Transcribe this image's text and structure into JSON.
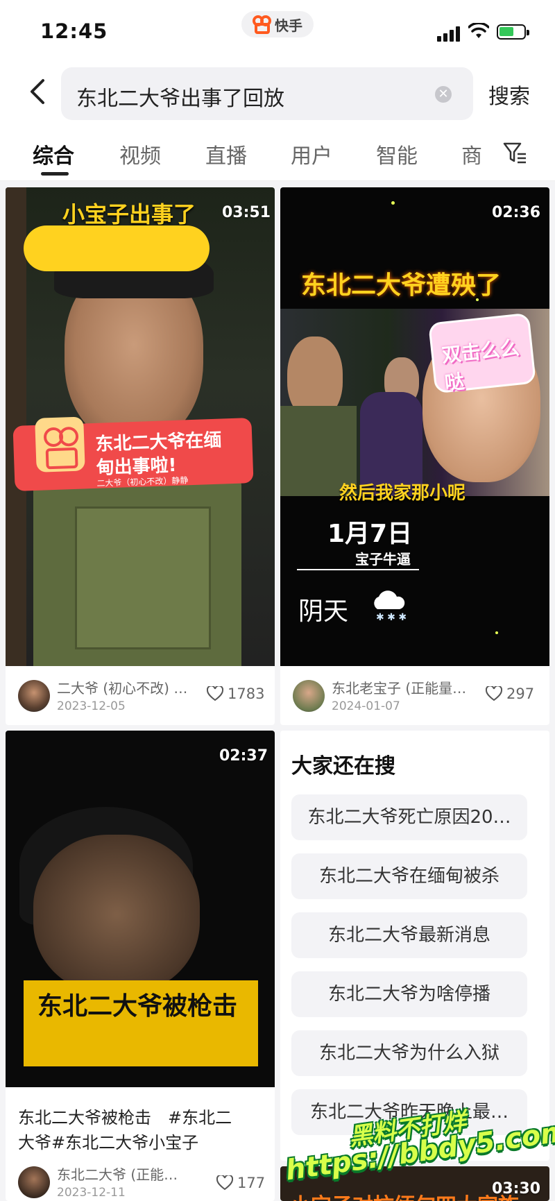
{
  "status": {
    "time": "12:45",
    "app_name": "快手"
  },
  "search": {
    "query": "东北二大爷出事了回放",
    "button_label": "搜索"
  },
  "tabs": [
    {
      "label": "综合",
      "active": true
    },
    {
      "label": "视频"
    },
    {
      "label": "直播"
    },
    {
      "label": "用户"
    },
    {
      "label": "智能"
    },
    {
      "label": "商"
    }
  ],
  "cards": [
    {
      "duration": "03:51",
      "overlay_title": "小宝子出事了",
      "banner_line1": "东北二大爷在缅",
      "banner_line2": "甸出事啦!",
      "banner_small": "二大爷（初心不改）静静",
      "author": "二大爷 (初心不改) …",
      "date": "2023-12-05",
      "likes": "1783"
    },
    {
      "duration": "02:36",
      "overlay_title": "东北二大爷遭殃了",
      "sticker": "双击么么哒",
      "subtitle": "然后我家那小呢",
      "date_overlay": "1月7日",
      "sign": "宝子牛逼",
      "weather": "阴天",
      "author": "东北老宝子 (正能量…",
      "date": "2024-01-07",
      "likes": "297"
    },
    {
      "duration": "02:37",
      "overlay_title": "东北二大爷被枪击",
      "caption_line1": "东北二大爷被枪击　#东北二",
      "caption_line2": "大爷#东北二大爷小宝子",
      "author": "东北二大爷 (正能…",
      "date": "2023-12-11",
      "likes": "177"
    },
    {
      "duration": "03:30",
      "overlay_title": "小宝子对抗缅甸四大家族"
    }
  ],
  "suggestions": {
    "title": "大家还在搜",
    "items": [
      "东北二大爷死亡原因20…",
      "东北二大爷在缅甸被杀",
      "东北二大爷最新消息",
      "东北二大爷为啥停播",
      "东北二大爷为什么入狱",
      "东北二大爷昨天晚上最…"
    ]
  },
  "watermark": {
    "line1": "黑料不打烊",
    "line2": "https://bbdy5.com"
  },
  "colors": {
    "accent": "#ff5a1f",
    "yellow": "#ffd21f",
    "banner_red": "#f04a4a",
    "gold_bar": "#e9b800"
  }
}
